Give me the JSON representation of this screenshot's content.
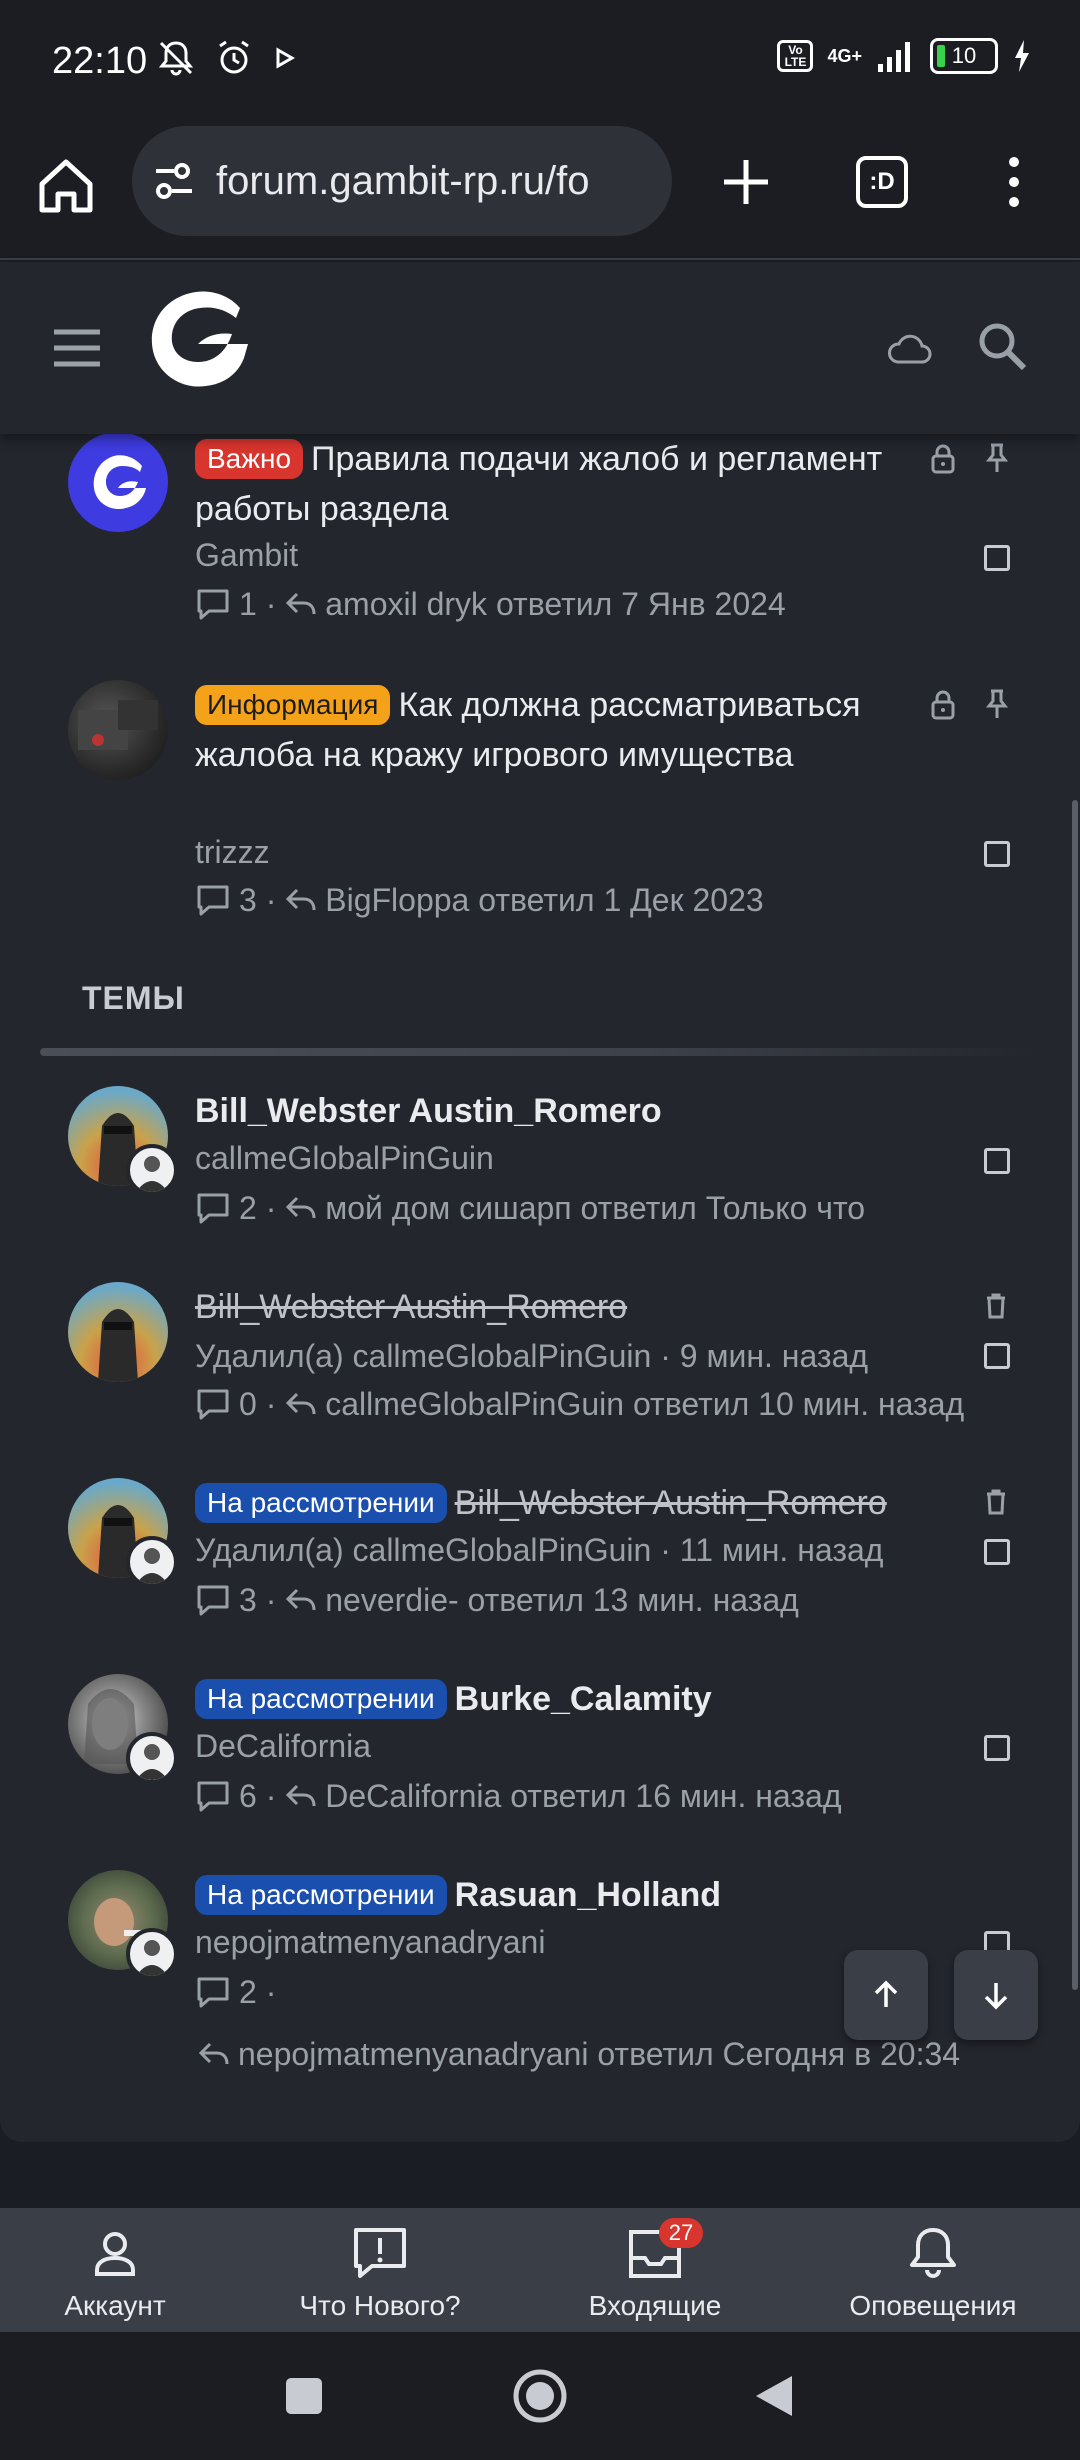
{
  "status_bar": {
    "time": "22:10",
    "network": "4G+",
    "volte": "Vo LTE",
    "battery": "10"
  },
  "browser": {
    "url": "forum.gambit-rp.ru/fo",
    "tabs_label": ":D"
  },
  "sticky_threads": [
    {
      "badge": "Важно",
      "title": "Правила подачи жалоб и регламент работы раздела",
      "author": "Gambit",
      "replies": "1",
      "last_reply": "amoxil dryk ответил 7 Янв 2024"
    },
    {
      "badge": "Информация",
      "title": "Как должна рассматриваться жалоба на кражу игрового имущества",
      "author": "trizzz",
      "replies": "3",
      "last_reply": "BigFloppa ответил 1 Дек 2023"
    }
  ],
  "section_title": "ТЕМЫ",
  "threads": [
    {
      "badge": "",
      "title": "Bill_Webster Austin_Romero",
      "author": "callmeGlobalPinGuin",
      "replies": "2",
      "last_reply": "мой дом сишарп ответил Только что"
    },
    {
      "badge": "",
      "title": "Bill_Webster Austin_Romero",
      "author": "Удалил(а) callmeGlobalPinGuin · 9 мин. назад",
      "replies": "0",
      "last_reply": "callmeGlobalPinGuin ответил 10 мин. назад"
    },
    {
      "badge": "На рассмотрении",
      "title": "Bill_Webster Austin_Romero",
      "author": "Удалил(а) callmeGlobalPinGuin · 11 мин. назад",
      "replies": "3",
      "last_reply": "neverdie- ответил 13 мин. назад"
    },
    {
      "badge": "На рассмотрении",
      "title": "Burke_Calamity",
      "author": "DeCalifornia",
      "replies": "6",
      "last_reply": "DeCalifornia ответил 16 мин. назад"
    },
    {
      "badge": "На рассмотрении",
      "title": "Rasuan_Holland",
      "author": "nepojmatmenyanadryani",
      "replies": "2",
      "last_reply": "nepojmatmenyanadryani ответил Сегодня в 20:34"
    }
  ],
  "bottom_nav": {
    "account": "Аккаунт",
    "whats_new": "Что Нового?",
    "inbox": "Входящие",
    "inbox_badge": "27",
    "alerts": "Оповещения"
  }
}
